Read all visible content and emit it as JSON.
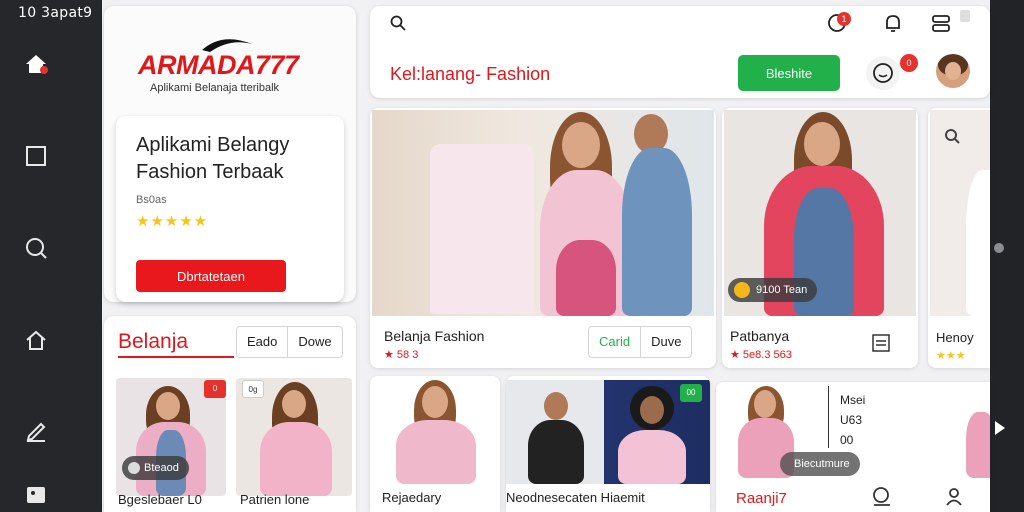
{
  "status_bar": {
    "text": "10 3apat9"
  },
  "left_rail": {
    "icons": [
      "home-icon",
      "square-icon",
      "search-icon",
      "home-outline-icon",
      "pen-icon",
      "gallery-icon"
    ]
  },
  "brand": {
    "logo_text": "ARMADA777",
    "tagline": "Aplikami Belanaja tteribalk"
  },
  "promo": {
    "title": "Aplikami Belangy Fashion Terbaak",
    "meta": "Bs0as",
    "stars": "★★★★★",
    "button_label": "Dbrtatetaen"
  },
  "shop_section": {
    "title": "Belanja",
    "segments": [
      "Eado",
      "Dowe"
    ],
    "items": [
      {
        "badge": "0",
        "pill": "Bteaod",
        "caption": "Bgeslebaer L0"
      },
      {
        "badge": "0g",
        "caption": "Patrien lone"
      }
    ]
  },
  "topbar": {
    "heading": "Kel:lanang- Fashion",
    "green_button": "Bleshite",
    "notif_count": "1",
    "chat_count": "0"
  },
  "products": [
    {
      "name": "Belanja Fashion",
      "rating": "★ 58 3",
      "seg": [
        "Carid",
        "Duve"
      ]
    },
    {
      "name": "Patbanya",
      "rating": "★ 5e8.3 563",
      "pill": "9100 Tean"
    },
    {
      "name": "Henoy",
      "rating": "★★★"
    }
  ],
  "bottom_products": [
    {
      "name": "Rejaedary"
    },
    {
      "name": "Neodnesecaten Hiaemit",
      "badge": "00"
    },
    {
      "name": "Raanji7",
      "lines": [
        "Msei",
        "U63",
        "00"
      ],
      "pill": "Biecutmure"
    }
  ],
  "colors": {
    "brand_red": "#e0181b",
    "accent_green": "#22b04b",
    "rail_dark": "#26272b",
    "star_yellow": "#f5c518"
  }
}
